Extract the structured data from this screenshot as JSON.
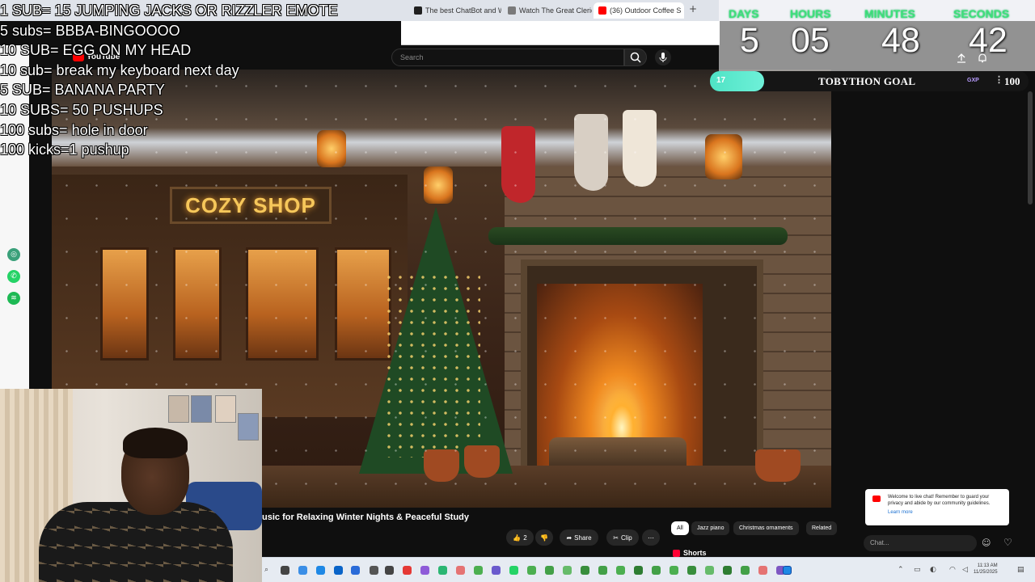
{
  "browser": {
    "tabs": [
      {
        "title": "The best ChatBot and Wri",
        "color": "#202020"
      },
      {
        "title": "Watch The Great Cleric Ep",
        "color": "#7a7a7a"
      },
      {
        "title": "(36) Outdoor Coffee S",
        "color": "#ff0000",
        "active": true
      }
    ],
    "newtab_glyph": "+"
  },
  "youtube": {
    "logo": "YouTube",
    "search_placeholder": "Search",
    "video_title": "usic for Relaxing Winter Nights & Peaceful Study",
    "like_count": "2",
    "share_label": "Share",
    "clip_label": "Clip",
    "more_glyph": "⋯",
    "chips": [
      "All",
      "Jazz piano",
      "Christmas ornaments",
      "Related"
    ],
    "selected_chip": "All",
    "shorts_label": "Shorts",
    "scene_sign": "COZY SHOP"
  },
  "chat": {
    "notice": "Welcome to live chat! Remember to guard your privacy and abide by our community guidelines.",
    "learn_more": "Learn more",
    "input_placeholder": "Chat..."
  },
  "overlay": {
    "sub_goals": [
      "1 SUB= 15 JUMPING JACKS OR RIZZLER EMOTE",
      "5 subs= BBBA-BINGOOOO",
      "10 SUB= EGG ON MY HEAD",
      "10 sub= break my keyboard next day",
      "5 SUB= BANANA  PARTY",
      "10 SUBS= 50 PUSHUPS",
      "100 subs= hole in door",
      "100 kicks=1 pushup"
    ],
    "timer": {
      "labels": [
        "DAYS",
        "HOURS",
        "MINUTES",
        "SECONDS"
      ],
      "values": [
        "5",
        "05",
        "48",
        "42"
      ]
    },
    "goal": {
      "current": "17",
      "target": "100",
      "progress": 0.17,
      "title": "TOBYTHON GOAL",
      "badge": "GXP",
      "more_glyph": "⋮"
    }
  },
  "taskbar": {
    "time": "11:13 AM",
    "date": "11/25/2025"
  },
  "colors": {
    "accent_green": "#3ee07a",
    "goal_fill": "#4fe3c5",
    "youtube_red": "#ff0000"
  }
}
